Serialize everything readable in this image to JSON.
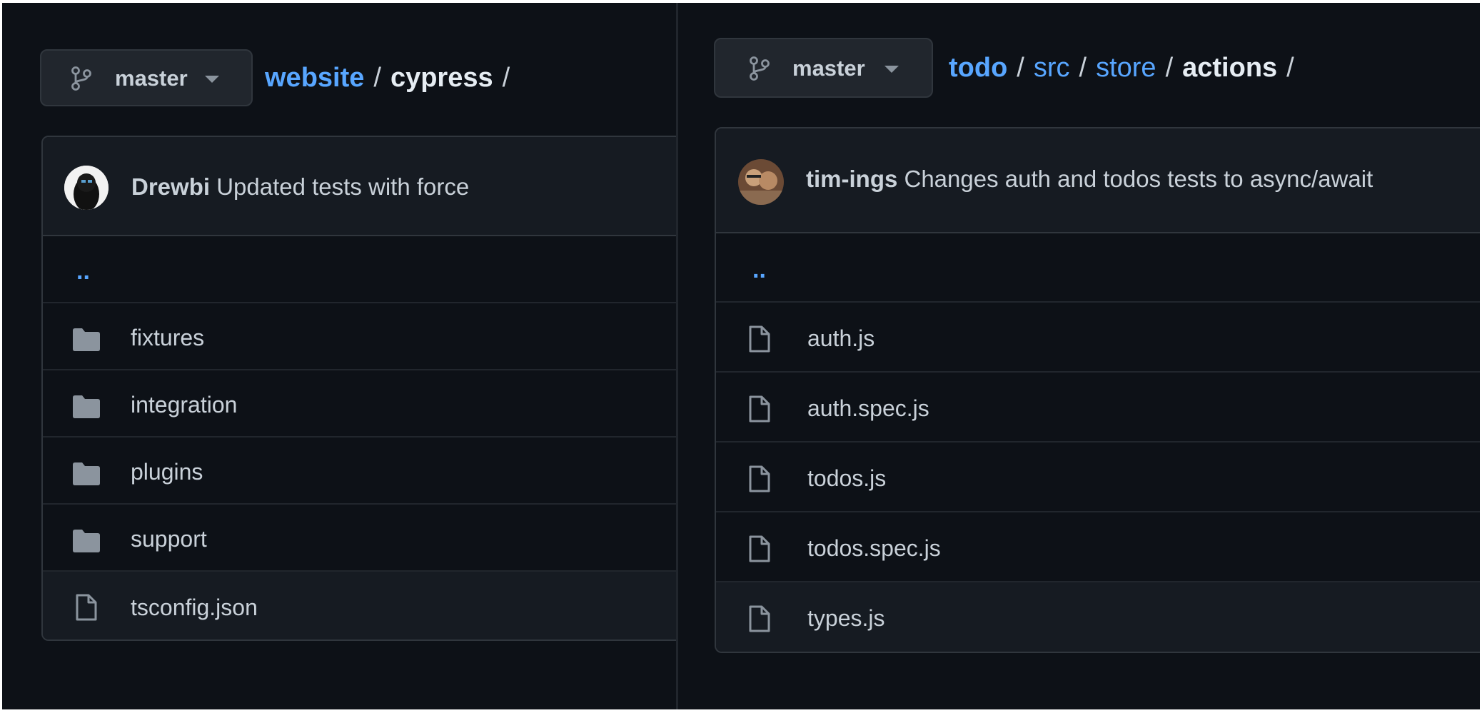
{
  "left_panel": {
    "branch": {
      "label": "master",
      "icon": "git-branch-icon"
    },
    "breadcrumb": {
      "root": "website",
      "separator": "/",
      "current": "cypress"
    },
    "commit": {
      "author": "Drewbi",
      "message": "Updated tests with force"
    },
    "parent_link": "..",
    "entries": [
      {
        "name": "fixtures",
        "type": "folder"
      },
      {
        "name": "integration",
        "type": "folder"
      },
      {
        "name": "plugins",
        "type": "folder"
      },
      {
        "name": "support",
        "type": "folder"
      },
      {
        "name": "tsconfig.json",
        "type": "file"
      }
    ]
  },
  "right_panel": {
    "branch": {
      "label": "master",
      "icon": "git-branch-icon"
    },
    "breadcrumb": {
      "root": "todo",
      "separator": "/",
      "segments": [
        "src",
        "store"
      ],
      "current": "actions"
    },
    "commit": {
      "author": "tim-ings",
      "message": "Changes auth and todos tests to async/await"
    },
    "parent_link": "..",
    "entries": [
      {
        "name": "auth.js",
        "type": "file"
      },
      {
        "name": "auth.spec.js",
        "type": "file"
      },
      {
        "name": "todos.js",
        "type": "file"
      },
      {
        "name": "todos.spec.js",
        "type": "file"
      },
      {
        "name": "types.js",
        "type": "file"
      }
    ]
  },
  "colors": {
    "background": "#0d1117",
    "link": "#58a6ff",
    "text": "#c9d1d9",
    "border": "#30363d",
    "folder_icon": "#8b949e"
  }
}
